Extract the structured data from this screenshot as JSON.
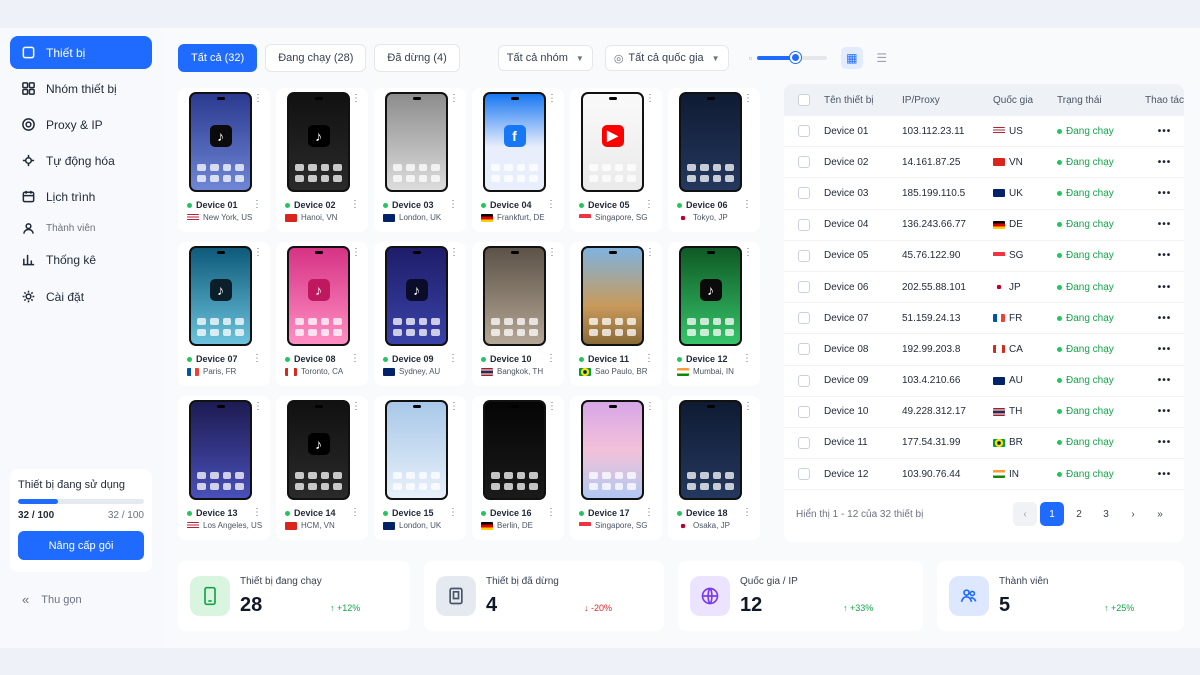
{
  "sidebar": {
    "items": [
      {
        "label": "Thiết bị",
        "icon": "phone-icon",
        "active": true
      },
      {
        "label": "Nhóm thiết bị",
        "icon": "group-icon"
      },
      {
        "label": "Proxy & IP",
        "icon": "globe-icon"
      },
      {
        "label": "Tự động hóa",
        "icon": "automation-icon"
      },
      {
        "label": "Lịch trình",
        "icon": "calendar-icon"
      },
      {
        "label": "Thành viên",
        "icon": "users-icon"
      },
      {
        "label": "Thống kê",
        "icon": "chart-icon"
      },
      {
        "label": "Cài đặt",
        "icon": "settings-icon"
      }
    ],
    "usage": {
      "title": "Thiết bị đang sử dụng",
      "used_label": "32 / 100",
      "total_label": "32 / 100",
      "fraction": 0.32,
      "upgrade_label": "Nâng cấp gói"
    },
    "collapse_label": "Thu gọn"
  },
  "filters": {
    "tabs": [
      {
        "label": "Tất cả (32)",
        "active": true
      },
      {
        "label": "Đang chạy (28)"
      },
      {
        "label": "Đã dừng (4)"
      }
    ],
    "group_select": "Tất cả nhóm",
    "country_select": "Tất cả quốc gia",
    "zoom_level": 0.55
  },
  "devices": [
    {
      "name": "Device 01",
      "location": "New York, US",
      "flag": "US",
      "theme": "blue-tiktok"
    },
    {
      "name": "Device 02",
      "location": "Hanoi, VN",
      "flag": "VN",
      "theme": "dark-tiktok"
    },
    {
      "name": "Device 03",
      "location": "London, UK",
      "flag": "UK",
      "theme": "grid-light"
    },
    {
      "name": "Device 04",
      "location": "Frankfurt, DE",
      "flag": "DE",
      "theme": "facebook"
    },
    {
      "name": "Device 05",
      "location": "Singapore, SG",
      "flag": "SG",
      "theme": "youtube"
    },
    {
      "name": "Device 06",
      "location": "Tokyo, JP",
      "flag": "JP",
      "theme": "dark-apps"
    },
    {
      "name": "Device 07",
      "location": "Paris, FR",
      "flag": "FR",
      "theme": "teal-tiktok"
    },
    {
      "name": "Device 08",
      "location": "Toronto, CA",
      "flag": "CA",
      "theme": "pink-tiktok"
    },
    {
      "name": "Device 09",
      "location": "Sydney, AU",
      "flag": "AU",
      "theme": "purple-tiktok"
    },
    {
      "name": "Device 10",
      "location": "Bangkok, TH",
      "flag": "TH",
      "theme": "photo-grid"
    },
    {
      "name": "Device 11",
      "location": "Sao Paulo, BR",
      "flag": "BR",
      "theme": "landscape"
    },
    {
      "name": "Device 12",
      "location": "Mumbai, IN",
      "flag": "IN",
      "theme": "green-tiktok"
    },
    {
      "name": "Device 13",
      "location": "Los Angeles, US",
      "flag": "US",
      "theme": "indigo-apps"
    },
    {
      "name": "Device 14",
      "location": "HCM, VN",
      "flag": "VN",
      "theme": "dark-tiktok"
    },
    {
      "name": "Device 15",
      "location": "London, UK",
      "flag": "UK",
      "theme": "light-apps"
    },
    {
      "name": "Device 16",
      "location": "Berlin, DE",
      "flag": "DE",
      "theme": "black-apps"
    },
    {
      "name": "Device 17",
      "location": "Singapore, SG",
      "flag": "SG",
      "theme": "pastel"
    },
    {
      "name": "Device 18",
      "location": "Osaka, JP",
      "flag": "JP",
      "theme": "dark-apps"
    }
  ],
  "table": {
    "headers": [
      "Tên thiết bị",
      "IP/Proxy",
      "Quốc gia",
      "Trạng thái",
      "Thao tác"
    ],
    "rows": [
      {
        "name": "Device 01",
        "ip": "103.112.23.11",
        "flag": "US",
        "country": "US",
        "status": "Đang chạy"
      },
      {
        "name": "Device 02",
        "ip": "14.161.87.25",
        "flag": "VN",
        "country": "VN",
        "status": "Đang chạy"
      },
      {
        "name": "Device 03",
        "ip": "185.199.110.5",
        "flag": "UK",
        "country": "UK",
        "status": "Đang chạy"
      },
      {
        "name": "Device 04",
        "ip": "136.243.66.77",
        "flag": "DE",
        "country": "DE",
        "status": "Đang chạy"
      },
      {
        "name": "Device 05",
        "ip": "45.76.122.90",
        "flag": "SG",
        "country": "SG",
        "status": "Đang chạy"
      },
      {
        "name": "Device 06",
        "ip": "202.55.88.101",
        "flag": "JP",
        "country": "JP",
        "status": "Đang chạy"
      },
      {
        "name": "Device 07",
        "ip": "51.159.24.13",
        "flag": "FR",
        "country": "FR",
        "status": "Đang chạy"
      },
      {
        "name": "Device 08",
        "ip": "192.99.203.8",
        "flag": "CA",
        "country": "CA",
        "status": "Đang chạy"
      },
      {
        "name": "Device 09",
        "ip": "103.4.210.66",
        "flag": "AU",
        "country": "AU",
        "status": "Đang chạy"
      },
      {
        "name": "Device 10",
        "ip": "49.228.312.17",
        "flag": "TH",
        "country": "TH",
        "status": "Đang chạy"
      },
      {
        "name": "Device 11",
        "ip": "177.54.31.99",
        "flag": "BR",
        "country": "BR",
        "status": "Đang chạy"
      },
      {
        "name": "Device 12",
        "ip": "103.90.76.44",
        "flag": "IN",
        "country": "IN",
        "status": "Đang chạy"
      }
    ],
    "pager_text": "Hiển thị 1 - 12 của 32 thiết bị",
    "pages": [
      "1",
      "2",
      "3"
    ],
    "current_page": "1"
  },
  "stats": [
    {
      "label": "Thiết bị đang chạy",
      "value": "28",
      "trend": "↑ +12%",
      "trend_color": "#16a34a",
      "icon": "phone-icon",
      "icon_bg": "#d9f5e0",
      "icon_color": "#16a34a"
    },
    {
      "label": "Thiết bị đã dừng",
      "value": "4",
      "trend": "↓ -20%",
      "trend_color": "#dc2626",
      "icon": "tablet-icon",
      "icon_bg": "#e5e9f0",
      "icon_color": "#475569"
    },
    {
      "label": "Quốc gia / IP",
      "value": "12",
      "trend": "↑ +33%",
      "trend_color": "#16a34a",
      "icon": "globe-icon",
      "icon_bg": "#ece4ff",
      "icon_color": "#7c3aed"
    },
    {
      "label": "Thành viên",
      "value": "5",
      "trend": "↑ +25%",
      "trend_color": "#16a34a",
      "icon": "users-icon",
      "icon_bg": "#dde8ff",
      "icon_color": "#1f6bff"
    }
  ],
  "colors": {
    "accent": "#1f6bff",
    "running": "#16a34a",
    "stopped": "#dc2626"
  }
}
